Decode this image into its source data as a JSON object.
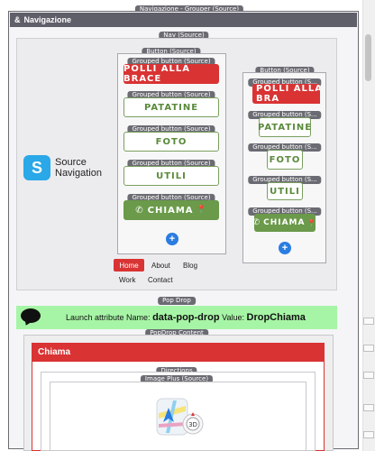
{
  "grouper": {
    "chip": "Navigazione - Grouper (Source)",
    "title": "Navigazione",
    "icon": "ampersand-icon"
  },
  "nav": {
    "chip": "Nav (Source)",
    "logo_letter": "S",
    "logo_line1": "Source",
    "logo_line2": "Navigation",
    "button_group_1": {
      "chip": "Button (Source)",
      "items": [
        {
          "chip": "Grouped button (Source)",
          "label": "POLLI ALLA BRACE"
        },
        {
          "chip": "Grouped button (Source)",
          "label": "PATATINE"
        },
        {
          "chip": "Grouped button (Source)",
          "label": "FOTO"
        },
        {
          "chip": "Grouped button (Source)",
          "label": "UTILI"
        },
        {
          "chip": "Grouped button (Source)",
          "label": "CHIAMA"
        }
      ]
    },
    "button_group_2": {
      "chip": "Button (Source)",
      "items": [
        {
          "chip": "Grouped button (S...",
          "label": "POLLI ALLA BRA"
        },
        {
          "chip": "Grouped button (S...",
          "label": "PATATINE"
        },
        {
          "chip": "Grouped button (S...",
          "label": "FOTO"
        },
        {
          "chip": "Grouped button (S...",
          "label": "UTILI"
        },
        {
          "chip": "Grouped button (S...",
          "label": "CHIAMA"
        }
      ]
    },
    "add_symbol": "+",
    "menu": [
      "Home",
      "About",
      "Blog",
      "Work",
      "Contact"
    ]
  },
  "pop_drop": {
    "chip": "Pop Drop",
    "text_prefix": "Launch attribute Name:",
    "attr_name": "data-pop-drop",
    "text_middle": "Value:",
    "attr_value": "DropChiama",
    "content_chip": "PopDrop Content",
    "header_title": "Chiama",
    "directions_chip": "Directions",
    "image_chip": "Image Plus (Source)",
    "map_badge": "3D"
  },
  "colors": {
    "red": "#d93333",
    "green": "#6a9a4a",
    "banner": "#a6f5a6",
    "header_bar": "#5f5f6a",
    "accent_blue": "#2a7de1"
  }
}
